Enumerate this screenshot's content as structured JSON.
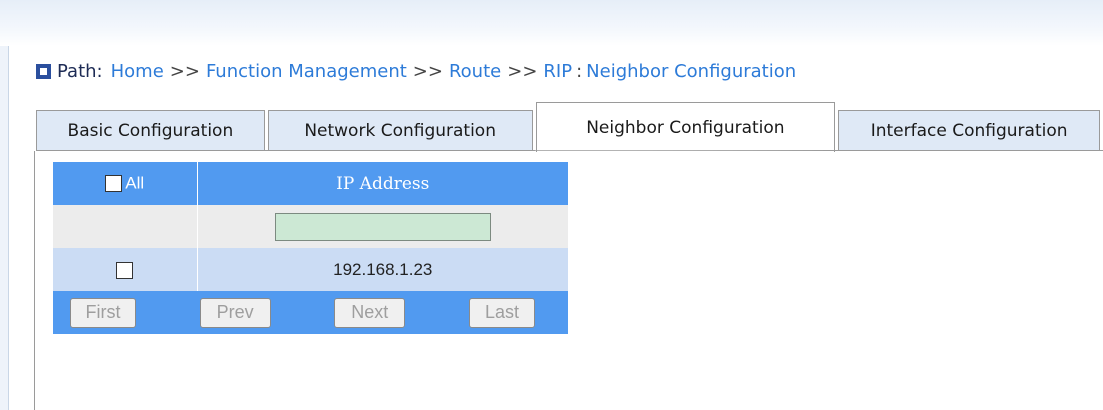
{
  "path": {
    "label": "Path:",
    "crumbs": [
      "Home",
      "Function Management",
      "Route",
      "RIP",
      "Neighbor Configuration"
    ],
    "separator": ">>",
    "colon": ":"
  },
  "tabs": [
    {
      "label": "Basic Configuration",
      "active": false
    },
    {
      "label": "Network Configuration",
      "active": false
    },
    {
      "label": "Neighbor Configuration",
      "active": true
    },
    {
      "label": "Interface Configuration",
      "active": false
    }
  ],
  "table": {
    "header": {
      "all_label": "All",
      "ip_header": "IP Address"
    },
    "input_value": "",
    "rows": [
      {
        "ip": "192.168.1.23",
        "checked": false
      }
    ]
  },
  "pager": {
    "first": "First",
    "prev": "Prev",
    "next": "Next",
    "last": "Last"
  },
  "colors": {
    "header_blue": "#519af0",
    "row_blue": "#cbdcf4",
    "input_green": "#cce8d4",
    "link_blue": "#2d7bd8"
  }
}
